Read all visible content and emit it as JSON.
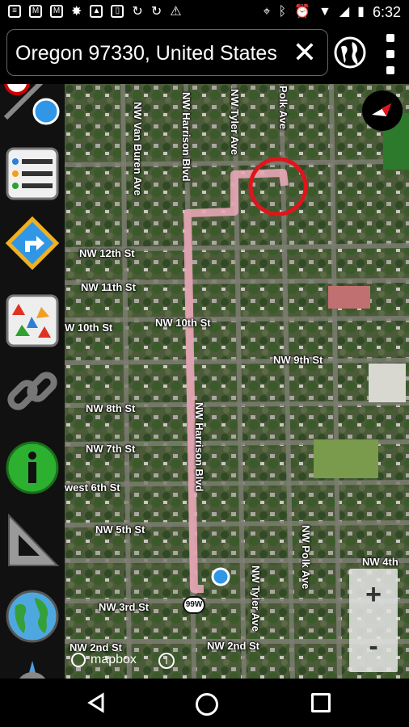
{
  "status_bar": {
    "time": "6:32"
  },
  "search": {
    "value": "Oregon 97330, United States",
    "close_icon": "close-icon"
  },
  "map": {
    "streets_vertical": [
      "NW Van Buren Ave",
      "NW Harrison Blvd",
      "NW Tyler Ave",
      "NW Polk Ave",
      "NW Harrison Blvd",
      "NW Tyler Ave",
      "NW Polk Ave"
    ],
    "streets": {
      "nw12": "NW 12th St",
      "nw11": "NW 11th St",
      "nw10a": "W 10th St",
      "nw10b": "NW 10th St",
      "nw9": "NW 9th St",
      "nw8": "NW 8th St",
      "nw7": "NW 7th St",
      "west6": "west 6th St",
      "nw5": "NW 5th St",
      "nw4": "NW 4th",
      "nw3": "NW 3rd St",
      "nw2a": "NW 2nd St",
      "nw2b": "NW 2nd St",
      "polk_top": "Polk Ave",
      "tyler_top": "NW Tyler Ave"
    },
    "route_shield": "99W",
    "attribution": "mapbox",
    "zoom_in": "+",
    "zoom_out": "-"
  },
  "colors": {
    "route": "#e8a6b6",
    "marker": "#e0141c",
    "location": "#2f97e6"
  }
}
